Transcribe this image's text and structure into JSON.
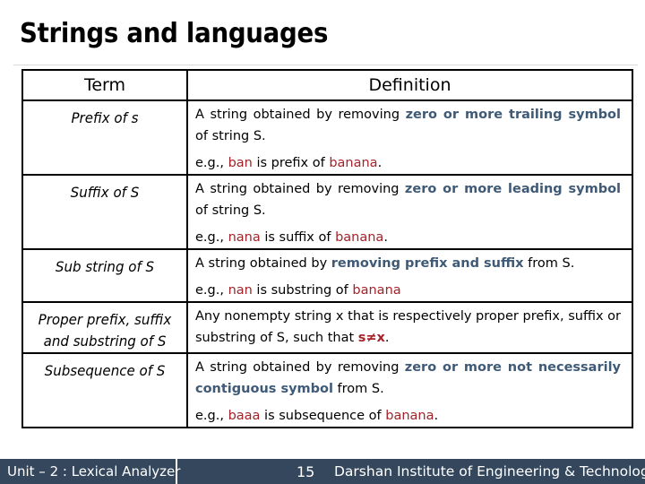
{
  "slide": {
    "title": "Strings and languages",
    "table": {
      "headers": {
        "term": "Term",
        "definition": "Definition"
      },
      "rows": [
        {
          "term": "Prefix of s",
          "definition": {
            "before": "A string obtained by removing ",
            "highlight": "zero or more trailing symbol",
            "after": " of string S.",
            "example": {
              "prefix": "e.g., ",
              "word": "ban",
              "middle": " is prefix of ",
              "target": "banana",
              "end": "."
            }
          }
        },
        {
          "term": "Suffix of S",
          "definition": {
            "before": "A string obtained by removing ",
            "highlight": "zero or more leading symbol",
            "after": " of string S.",
            "example": {
              "prefix": "e.g., ",
              "word": "nana",
              "middle": " is suffix of ",
              "target": "banana",
              "end": "."
            }
          }
        },
        {
          "term": "Sub string of S",
          "definition": {
            "before": "A string obtained by ",
            "highlight": "removing prefix and suffix",
            "after": " from S.",
            "example": {
              "prefix": "e.g., ",
              "word": "nan",
              "middle": " is substring of ",
              "target": "banana",
              "end": ""
            }
          }
        },
        {
          "term_lines": [
            "Proper prefix, suffix",
            "and substring of S"
          ],
          "definition": {
            "before": "Any nonempty string x that is respectively proper prefix, suffix or substring of S, such that ",
            "condition": "s≠x",
            "after": "."
          }
        },
        {
          "term": "Subsequence of S",
          "definition": {
            "before": "A string obtained by removing ",
            "highlight": "zero or more not necessarily contiguous symbol",
            "after": " from S.",
            "example": {
              "prefix": "e.g., ",
              "word": "baaa",
              "middle": " is subsequence of ",
              "target": "banana",
              "end": "."
            }
          }
        }
      ]
    }
  },
  "footer": {
    "unit": "Unit – 2 : Lexical Analyzer",
    "page_number": "15",
    "institute": "Darshan Institute of Engineering & Technology"
  },
  "colors": {
    "highlight_blue": "#3f5a77",
    "example_red": "#a3232a",
    "footer_bg": "#34475c"
  }
}
